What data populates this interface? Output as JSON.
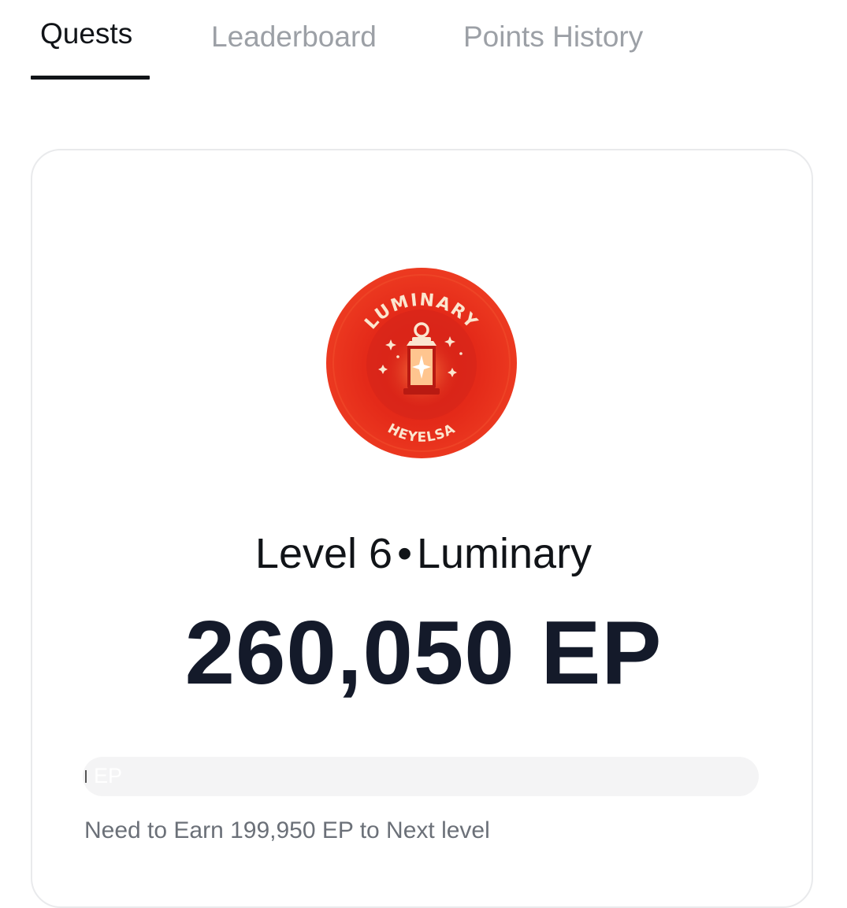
{
  "tabs": [
    {
      "label": "Quests",
      "active": true
    },
    {
      "label": "Leaderboard",
      "active": false
    },
    {
      "label": "Points History",
      "active": false
    }
  ],
  "badge": {
    "icon": "lantern-icon",
    "title": "LUMINARY",
    "subtitle": "HEYELSA",
    "color": "#e52818"
  },
  "level": {
    "prefix": "Level 6",
    "separator": "•",
    "name": "Luminary"
  },
  "points": {
    "value": "260,050 EP"
  },
  "progress": {
    "label": "EP",
    "fraction": 0.0
  },
  "next_level": {
    "text": "Need to Earn 199,950 EP to Next level"
  },
  "colors": {
    "accent": "#111418",
    "muted": "#9ca0a6",
    "badge_red": "#e52818"
  }
}
